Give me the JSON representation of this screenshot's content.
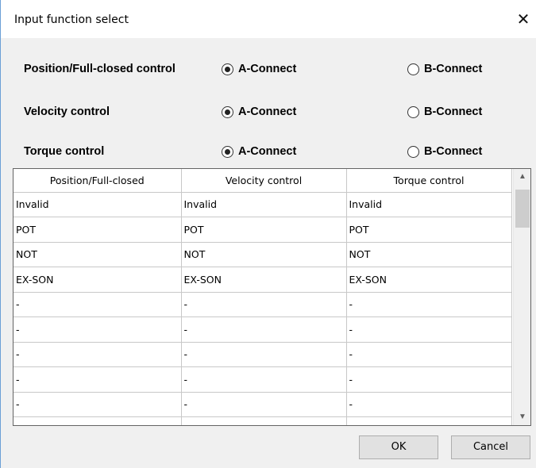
{
  "window": {
    "title": "Input function select",
    "close_symbol": "✕"
  },
  "options": [
    {
      "label": "Position/Full-closed control",
      "a_label": "A-Connect",
      "b_label": "B-Connect",
      "selected": "A"
    },
    {
      "label": "Velocity control",
      "a_label": "A-Connect",
      "b_label": "B-Connect",
      "selected": "A"
    },
    {
      "label": "Torque control",
      "a_label": "A-Connect",
      "b_label": "B-Connect",
      "selected": "A"
    }
  ],
  "table": {
    "headers": [
      "Position/Full-closed",
      "Velocity control",
      "Torque control"
    ],
    "rows": [
      [
        "Invalid",
        "Invalid",
        "Invalid"
      ],
      [
        "POT",
        "POT",
        "POT"
      ],
      [
        "NOT",
        "NOT",
        "NOT"
      ],
      [
        "EX-SON",
        "EX-SON",
        "EX-SON"
      ],
      [
        "-",
        "-",
        "-"
      ],
      [
        "-",
        "-",
        "-"
      ],
      [
        "-",
        "-",
        "-"
      ],
      [
        "-",
        "-",
        "-"
      ],
      [
        "-",
        "-",
        "-"
      ],
      [
        "",
        "",
        ""
      ]
    ]
  },
  "scrollbar": {
    "up_arrow": "▲",
    "down_arrow": "▼"
  },
  "buttons": {
    "ok": "OK",
    "cancel": "Cancel"
  }
}
